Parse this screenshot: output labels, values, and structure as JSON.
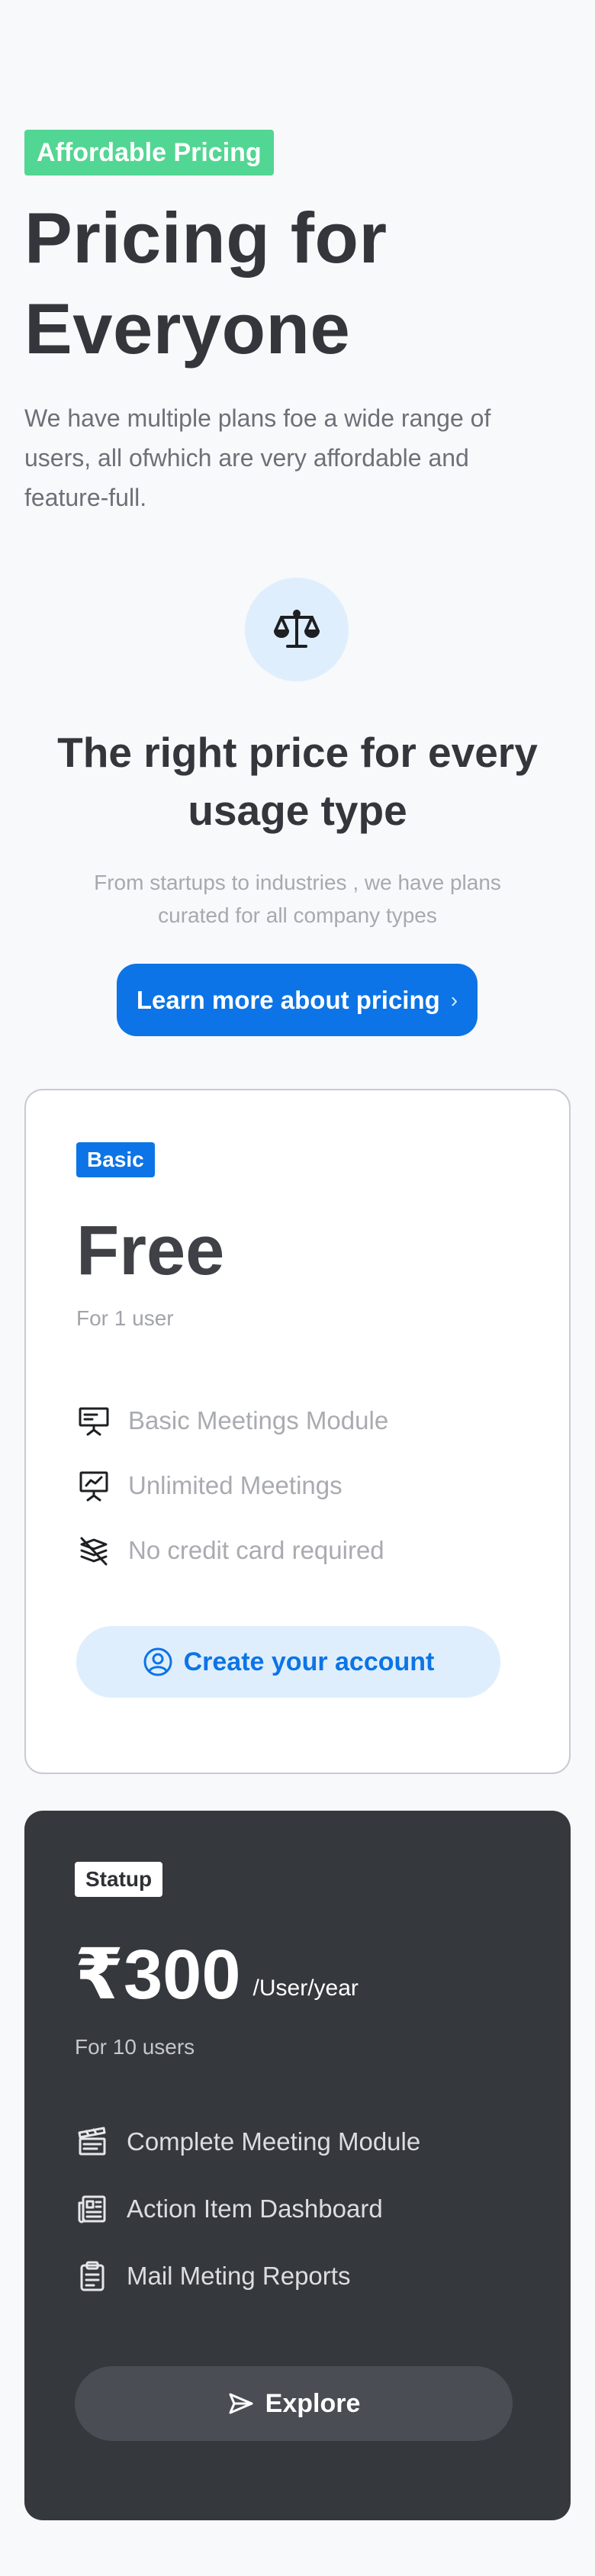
{
  "hero": {
    "badge": "Affordable Pricing",
    "title_line1": "Pricing for",
    "title_line2": "Everyone",
    "description": "We have multiple plans foe a wide range of users, all ofwhich are very affordable and feature-full."
  },
  "feature": {
    "icon": "scale-balance-icon",
    "title": "The right price for every usage type",
    "description": "From startups to industries , we have plans curated for all company types",
    "button_label": "Learn more about pricing",
    "button_chevron": "›"
  },
  "plans": {
    "basic": {
      "badge": "Basic",
      "price": "Free",
      "subtitle": "For 1 user",
      "features": [
        {
          "icon": "presentation-icon",
          "label": "Basic Meetings Module"
        },
        {
          "icon": "chart-board-icon",
          "label": "Unlimited Meetings"
        },
        {
          "icon": "no-credit-card-icon",
          "label": "No credit card required"
        }
      ],
      "button_label": "Create your account",
      "button_icon": "user-circle-icon"
    },
    "startup": {
      "badge": "Statup",
      "price": "₹300",
      "price_unit": "/User/year",
      "subtitle": "For 10 users",
      "features": [
        {
          "icon": "clapperboard-icon",
          "label": "Complete Meeting Module"
        },
        {
          "icon": "dashboard-icon",
          "label": "Action Item Dashboard"
        },
        {
          "icon": "clipboard-icon",
          "label": "Mail Meting Reports"
        }
      ],
      "button_label": "Explore",
      "button_icon": "send-icon"
    }
  },
  "colors": {
    "accent": "#0c74e6",
    "badge_green": "#52d693",
    "dark_card": "#35383d",
    "page_bg": "#f8f9fb"
  }
}
